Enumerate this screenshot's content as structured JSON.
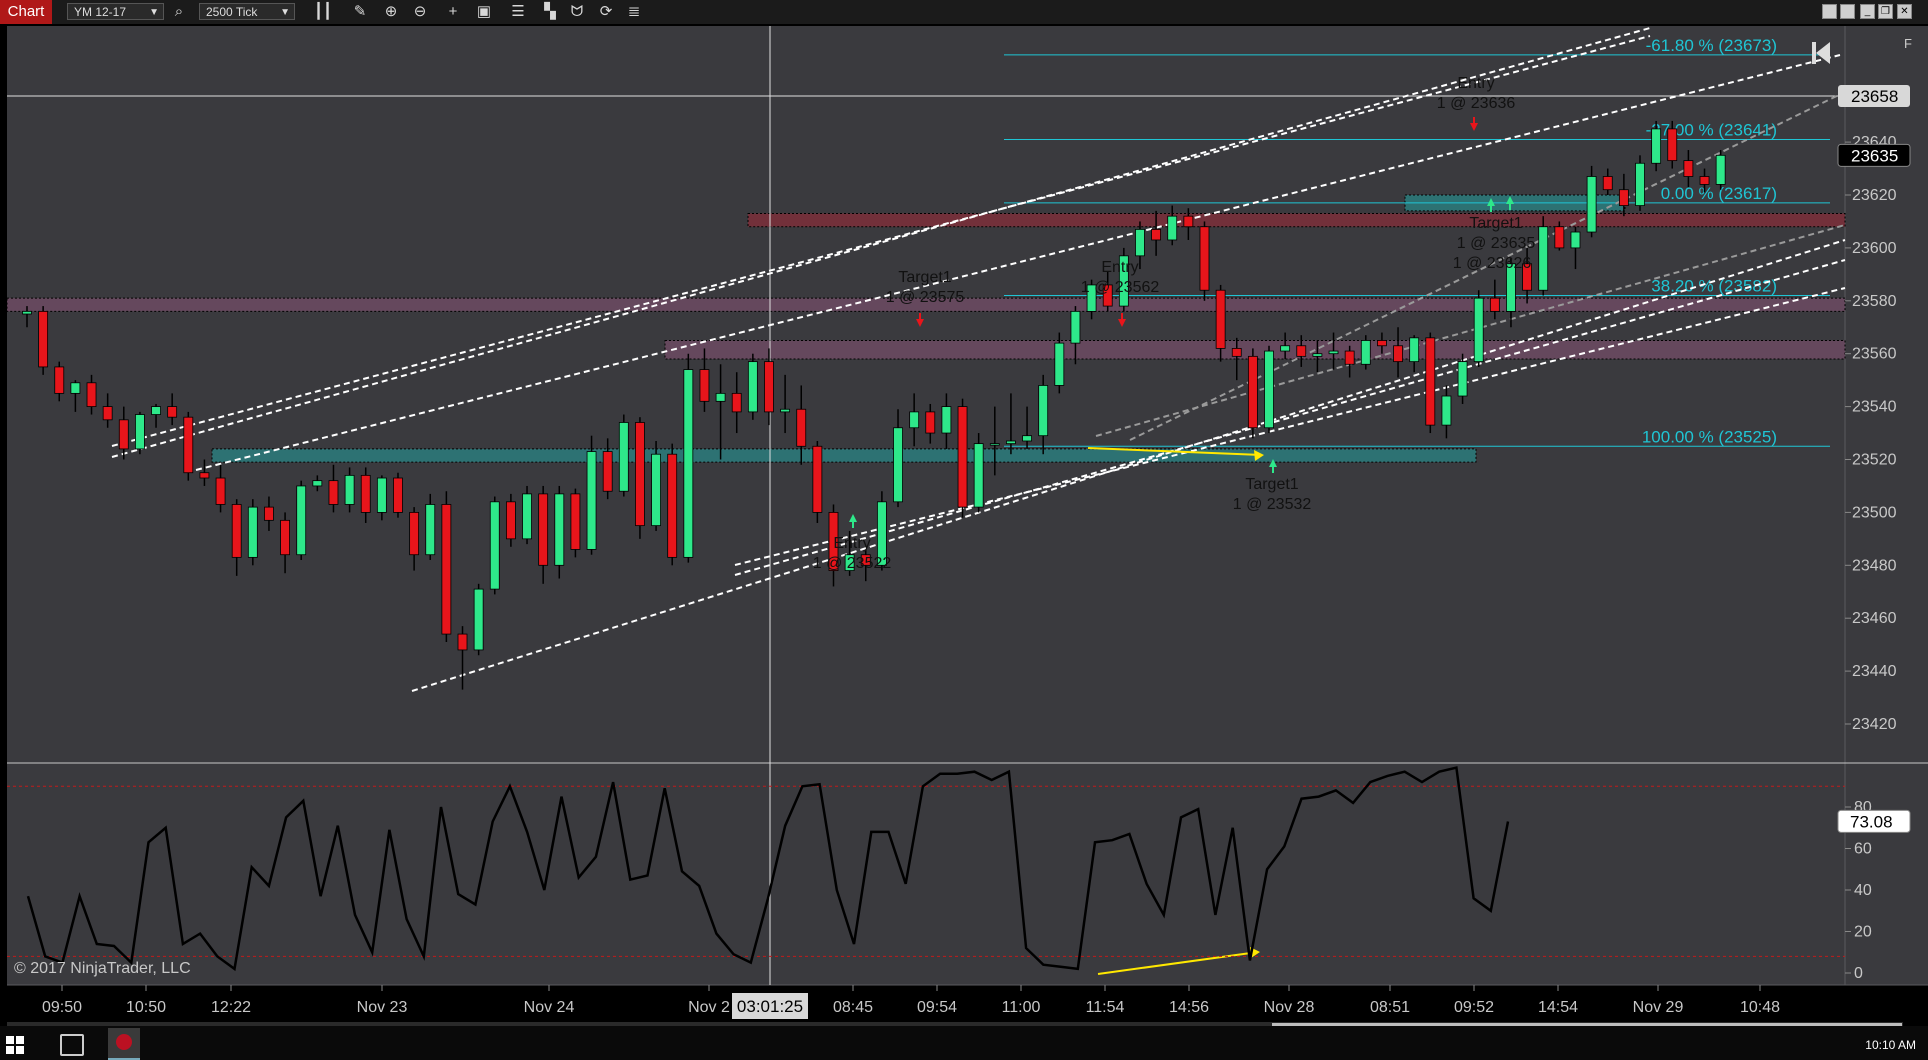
{
  "toolbar": {
    "tab_label": "Chart",
    "instrument": "YM 12-17",
    "period": "2500 Tick",
    "icons": [
      "search-icon",
      "bar-type-icon",
      "pencil-icon",
      "zoom-in-icon",
      "zoom-out-icon",
      "crosshair-icon",
      "properties-icon",
      "data-box-icon",
      "strategies-icon",
      "indicators-icon",
      "refresh-icon",
      "list-icon"
    ]
  },
  "window_buttons": [
    "minimize",
    "restore",
    "maximize",
    "close"
  ],
  "f_label": "F",
  "price_axis": {
    "ticks": [
      "23640",
      "23620",
      "23600",
      "23580",
      "23560",
      "23540",
      "23520",
      "23500",
      "23480",
      "23460",
      "23440",
      "23420"
    ],
    "crosshair_price": "23658",
    "last_price": "23635"
  },
  "osc_axis": {
    "ticks": [
      "80",
      "60",
      "40",
      "20",
      "0"
    ],
    "current_value": "73.08",
    "overbought": 90,
    "oversold": 8
  },
  "time_axis": {
    "labels": [
      "09:50",
      "10:50",
      "12:22",
      "Nov 23",
      "Nov 24",
      "Nov 2",
      "08:45",
      "09:54",
      "11:00",
      "11:54",
      "14:56",
      "Nov 28",
      "08:51",
      "09:52",
      "14:54",
      "Nov 29",
      "10:48"
    ],
    "crosshair_time": "03:01:25"
  },
  "fib_levels": [
    {
      "label": "-61.80 % (23673)",
      "price": 23673
    },
    {
      "label": "-27.00 % (23641)",
      "price": 23641
    },
    {
      "label": "0.00 % (23617)",
      "price": 23617
    },
    {
      "label": "38.20 % (23582)",
      "price": 23582
    },
    {
      "label": "100.00 % (23525)",
      "price": 23525
    }
  ],
  "trade_labels": [
    {
      "title": "Entry",
      "detail": "1 @ 23522"
    },
    {
      "title": "Target1",
      "detail": "1 @ 23575"
    },
    {
      "title": "Entry",
      "detail": "1 @ 23562"
    },
    {
      "title": "Target1",
      "detail": "1 @ 23532"
    },
    {
      "title": "Entry",
      "detail": "1 @ 23636"
    },
    {
      "title": "Target1",
      "detail": "1 @ 23635"
    },
    {
      "title": "",
      "detail": "1 @ 23626"
    }
  ],
  "copyright": "© 2017 NinjaTrader, LLC",
  "taskbar": {
    "clock": "10:10 AM"
  },
  "colors": {
    "background": "#3a3a3e",
    "up_candle": "#2ee88a",
    "down_candle": "#e8151b",
    "fib_line": "#1fc5d4",
    "supply_zone": "#7c2f3a",
    "demand_zone": "#2b7c7d",
    "channel": "#ffffff",
    "divergence": "#ffe800",
    "oscillator": "#000000"
  },
  "chart_data": {
    "type": "candlestick",
    "price_ylim": [
      23420,
      23660
    ],
    "candles": [
      [
        23575,
        23578,
        23570,
        23576
      ],
      [
        23576,
        23578,
        23552,
        23555
      ],
      [
        23555,
        23557,
        23542,
        23545
      ],
      [
        23545,
        23550,
        23538,
        23549
      ],
      [
        23549,
        23552,
        23537,
        23540
      ],
      [
        23540,
        23545,
        23532,
        23535
      ],
      [
        23535,
        23540,
        23520,
        23524
      ],
      [
        23524,
        23538,
        23522,
        23537
      ],
      [
        23537,
        23541,
        23532,
        23540
      ],
      [
        23540,
        23545,
        23533,
        23536
      ],
      [
        23536,
        23538,
        23512,
        23515
      ],
      [
        23515,
        23520,
        23510,
        23513
      ],
      [
        23513,
        23518,
        23500,
        23503
      ],
      [
        23503,
        23505,
        23476,
        23483
      ],
      [
        23483,
        23505,
        23480,
        23502
      ],
      [
        23502,
        23506,
        23493,
        23497
      ],
      [
        23497,
        23500,
        23477,
        23484
      ],
      [
        23484,
        23512,
        23482,
        23510
      ],
      [
        23510,
        23514,
        23508,
        23512
      ],
      [
        23512,
        23518,
        23500,
        23503
      ],
      [
        23503,
        23517,
        23500,
        23514
      ],
      [
        23514,
        23517,
        23496,
        23500
      ],
      [
        23500,
        23514,
        23497,
        23513
      ],
      [
        23513,
        23515,
        23498,
        23500
      ],
      [
        23500,
        23502,
        23478,
        23484
      ],
      [
        23484,
        23507,
        23482,
        23503
      ],
      [
        23503,
        23508,
        23451,
        23454
      ],
      [
        23454,
        23457,
        23433,
        23448
      ],
      [
        23448,
        23473,
        23446,
        23471
      ],
      [
        23471,
        23506,
        23469,
        23504
      ],
      [
        23504,
        23507,
        23487,
        23490
      ],
      [
        23490,
        23510,
        23488,
        23507
      ],
      [
        23507,
        23510,
        23473,
        23480
      ],
      [
        23480,
        23510,
        23475,
        23507
      ],
      [
        23507,
        23509,
        23483,
        23486
      ],
      [
        23486,
        23529,
        23484,
        23523
      ],
      [
        23523,
        23528,
        23505,
        23508
      ],
      [
        23508,
        23537,
        23506,
        23534
      ],
      [
        23534,
        23536,
        23490,
        23495
      ],
      [
        23495,
        23527,
        23493,
        23522
      ],
      [
        23522,
        23526,
        23480,
        23483
      ],
      [
        23483,
        23560,
        23481,
        23554
      ],
      [
        23554,
        23562,
        23538,
        23542
      ],
      [
        23542,
        23556,
        23520,
        23545
      ],
      [
        23545,
        23553,
        23530,
        23538
      ],
      [
        23538,
        23560,
        23535,
        23557
      ],
      [
        23557,
        23562,
        23533,
        23538
      ],
      [
        23538,
        23552,
        23530,
        23539
      ],
      [
        23539,
        23548,
        23518,
        23525
      ],
      [
        23525,
        23527,
        23496,
        23500
      ],
      [
        23500,
        23503,
        23472,
        23478
      ],
      [
        23478,
        23493,
        23476,
        23484
      ],
      [
        23484,
        23486,
        23474,
        23480
      ],
      [
        23480,
        23508,
        23478,
        23504
      ],
      [
        23504,
        23539,
        23502,
        23532
      ],
      [
        23532,
        23545,
        23525,
        23538
      ],
      [
        23538,
        23541,
        23526,
        23530
      ],
      [
        23530,
        23545,
        23524,
        23540
      ],
      [
        23540,
        23543,
        23498,
        23502
      ],
      [
        23502,
        23530,
        23500,
        23526
      ],
      [
        23526,
        23540,
        23514,
        23526
      ],
      [
        23526,
        23545,
        23522,
        23527
      ],
      [
        23527,
        23540,
        23524,
        23529
      ],
      [
        23529,
        23552,
        23522,
        23548
      ],
      [
        23548,
        23568,
        23545,
        23564
      ],
      [
        23564,
        23578,
        23556,
        23576
      ],
      [
        23576,
        23588,
        23573,
        23586
      ],
      [
        23586,
        23591,
        23576,
        23578
      ],
      [
        23578,
        23600,
        23576,
        23597
      ],
      [
        23597,
        23610,
        23592,
        23607
      ],
      [
        23607,
        23614,
        23597,
        23603
      ],
      [
        23603,
        23616,
        23601,
        23612
      ],
      [
        23612,
        23615,
        23603,
        23608
      ],
      [
        23608,
        23610,
        23580,
        23584
      ],
      [
        23584,
        23586,
        23557,
        23562
      ],
      [
        23562,
        23566,
        23550,
        23559
      ],
      [
        23559,
        23562,
        23528,
        23532
      ],
      [
        23532,
        23563,
        23530,
        23561
      ],
      [
        23561,
        23568,
        23558,
        23563
      ],
      [
        23563,
        23567,
        23555,
        23559
      ],
      [
        23559,
        23565,
        23553,
        23560
      ],
      [
        23560,
        23568,
        23554,
        23561
      ],
      [
        23561,
        23563,
        23551,
        23556
      ],
      [
        23556,
        23567,
        23554,
        23565
      ],
      [
        23565,
        23568,
        23560,
        23563
      ],
      [
        23563,
        23570,
        23551,
        23557
      ],
      [
        23557,
        23567,
        23553,
        23566
      ],
      [
        23566,
        23568,
        23530,
        23533
      ],
      [
        23533,
        23548,
        23528,
        23544
      ],
      [
        23544,
        23560,
        23541,
        23557
      ],
      [
        23557,
        23584,
        23555,
        23581
      ],
      [
        23581,
        23588,
        23573,
        23576
      ],
      [
        23576,
        23596,
        23570,
        23594
      ],
      [
        23594,
        23600,
        23579,
        23584
      ],
      [
        23584,
        23612,
        23582,
        23608
      ],
      [
        23608,
        23610,
        23599,
        23600
      ],
      [
        23600,
        23608,
        23592,
        23606
      ],
      [
        23606,
        23631,
        23604,
        23627
      ],
      [
        23627,
        23630,
        23620,
        23622
      ],
      [
        23622,
        23628,
        23612,
        23616
      ],
      [
        23616,
        23635,
        23614,
        23632
      ],
      [
        23632,
        23648,
        23629,
        23645
      ],
      [
        23645,
        23648,
        23630,
        23633
      ],
      [
        23633,
        23637,
        23623,
        23627
      ],
      [
        23627,
        23630,
        23621,
        23624
      ],
      [
        23624,
        23637,
        23622,
        23635
      ]
    ],
    "oscillator": [
      37,
      8,
      5,
      37,
      14,
      13,
      5,
      63,
      70,
      14,
      19,
      8,
      2,
      51,
      42,
      75,
      83,
      37,
      71,
      28,
      10,
      69,
      26,
      8,
      80,
      38,
      33,
      73,
      90,
      68,
      40,
      85,
      46,
      56,
      92,
      45,
      47,
      89,
      49,
      42,
      19,
      9,
      5,
      36,
      71,
      90,
      91,
      40,
      14,
      68,
      68,
      43,
      90,
      96,
      96,
      97,
      93,
      97,
      12,
      4,
      3,
      2,
      63,
      64,
      67,
      43,
      28,
      75,
      79,
      28,
      70,
      6,
      50,
      61,
      84,
      85,
      88,
      82,
      92,
      95,
      97,
      92,
      97,
      99,
      36,
      30,
      73
    ]
  }
}
